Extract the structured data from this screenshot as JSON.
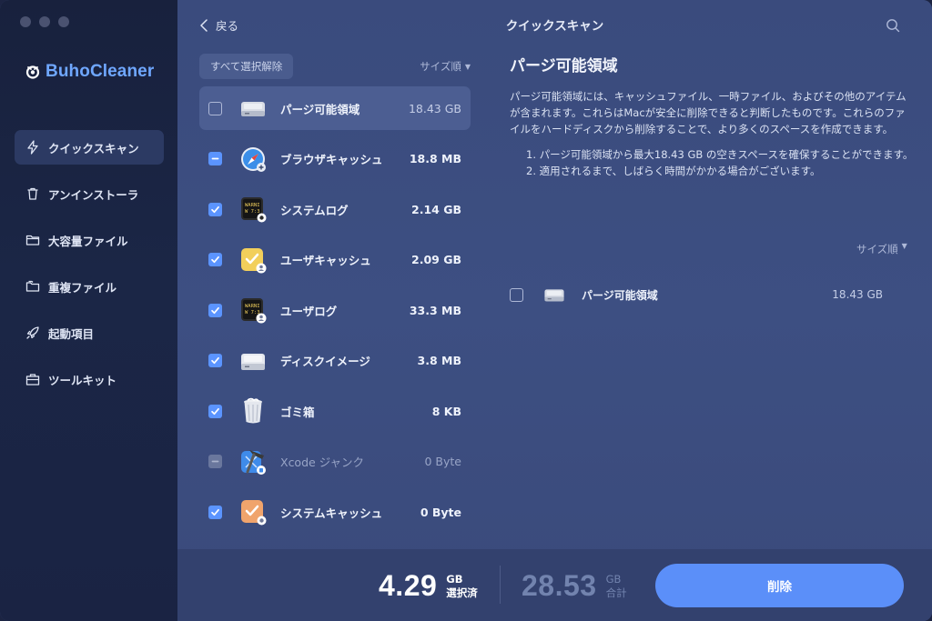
{
  "app": {
    "name": "BuhoCleaner"
  },
  "sidebar": {
    "items": [
      {
        "label": "クイックスキャン",
        "icon": "lightning-icon",
        "active": true
      },
      {
        "label": "アンインストーラ",
        "icon": "trash-icon"
      },
      {
        "label": "大容量ファイル",
        "icon": "folder-icon"
      },
      {
        "label": "重複ファイル",
        "icon": "duplicate-folder-icon"
      },
      {
        "label": "起動項目",
        "icon": "rocket-icon"
      },
      {
        "label": "ツールキット",
        "icon": "toolkit-icon"
      }
    ]
  },
  "header": {
    "back_label": "戻る",
    "title": "クイックスキャン"
  },
  "list": {
    "select_all_label": "すべて選択解除",
    "sort_label": "サイズ順",
    "rows": [
      {
        "label": "パージ可能領域",
        "size": "18.43 GB",
        "state": "empty",
        "icon": "disk-icon"
      },
      {
        "label": "ブラウザキャッシュ",
        "size": "18.8 MB",
        "state": "partial",
        "icon": "safari-icon"
      },
      {
        "label": "システムログ",
        "size": "2.14 GB",
        "state": "checked",
        "icon": "console-icon"
      },
      {
        "label": "ユーザキャッシュ",
        "size": "2.09 GB",
        "state": "checked",
        "icon": "user-cache-icon"
      },
      {
        "label": "ユーザログ",
        "size": "33.3 MB",
        "state": "checked",
        "icon": "user-log-icon"
      },
      {
        "label": "ディスクイメージ",
        "size": "3.8 MB",
        "state": "checked",
        "icon": "disk-image-icon"
      },
      {
        "label": "ゴミ箱",
        "size": "8 KB",
        "state": "checked",
        "icon": "trash-bin-icon"
      },
      {
        "label": "Xcode ジャンク",
        "size": "0 Byte",
        "state": "disabled",
        "icon": "xcode-icon"
      },
      {
        "label": "システムキャッシュ",
        "size": "0 Byte",
        "state": "checked",
        "icon": "system-cache-icon"
      }
    ]
  },
  "detail": {
    "title": "パージ可能領域",
    "description": "パージ可能領域には、キャッシュファイル、一時ファイル、およびその他のアイテムが含まれます。これらはMacが安全に削除できると判断したものです。これらのファイルをハードディスクから削除することで、より多くのスペースを作成できます。",
    "notes": [
      "1. パージ可能領域から最大18.43 GB の空きスペースを確保することができます。",
      "2. 適用されるまで、しばらく時間がかかる場合がございます。"
    ],
    "sort_label": "サイズ順",
    "item": {
      "label": "パージ可能領域",
      "size": "18.43 GB"
    }
  },
  "footer": {
    "selected_value": "4.29",
    "selected_unit": "GB",
    "selected_caption": "選択済",
    "total_value": "28.53",
    "total_unit": "GB",
    "total_caption": "合計",
    "delete_label": "削除"
  },
  "colors": {
    "accent": "#5b8ff9",
    "brand": "#6fa7ff"
  }
}
